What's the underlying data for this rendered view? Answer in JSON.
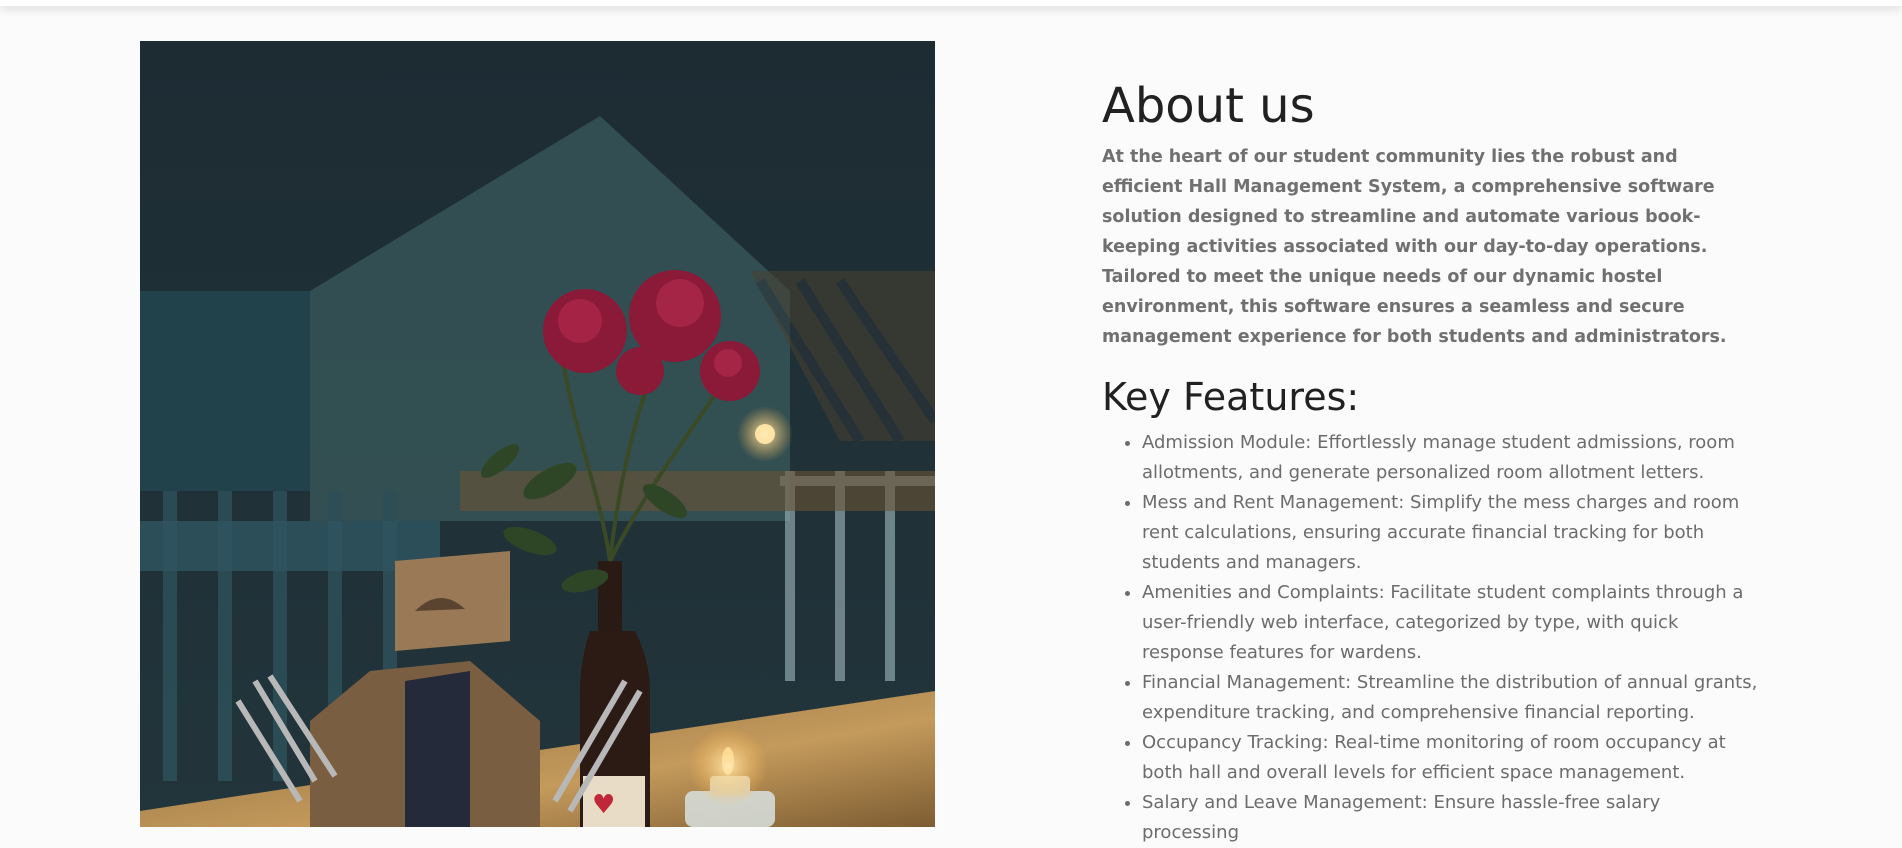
{
  "page": {
    "title": "About us",
    "intro": "At the heart of our student community lies the robust and efficient Hall Management System, a comprehensive software solution designed to streamline and automate various book-keeping activities associated with our day-to-day operations. Tailored to meet the unique needs of our dynamic hostel environment, this software ensures a seamless and secure management experience for both students and administrators.",
    "features_heading": "Key Features:",
    "features": [
      "Admission Module: Effortlessly manage student admissions, room allotments, and generate personalized room allotment letters.",
      "Mess and Rent Management: Simplify the mess charges and room rent calculations, ensuring accurate financial tracking for both students and managers.",
      "Amenities and Complaints: Facilitate student complaints through a user-friendly web interface, categorized by type, with quick response features for wardens.",
      "Financial Management: Streamline the distribution of annual grants, expenditure tracking, and comprehensive financial reporting.",
      "Occupancy Tracking: Real-time monitoring of room occupancy at both hall and overall levels for efficient space management.",
      "Salary and Leave Management: Ensure hassle-free salary processing"
    ]
  },
  "image": {
    "subject": "restaurant-table-flowers-photo"
  },
  "colors": {
    "heading": "#212121",
    "body_text": "#6c6c6c",
    "background": "#fbfbfb"
  }
}
